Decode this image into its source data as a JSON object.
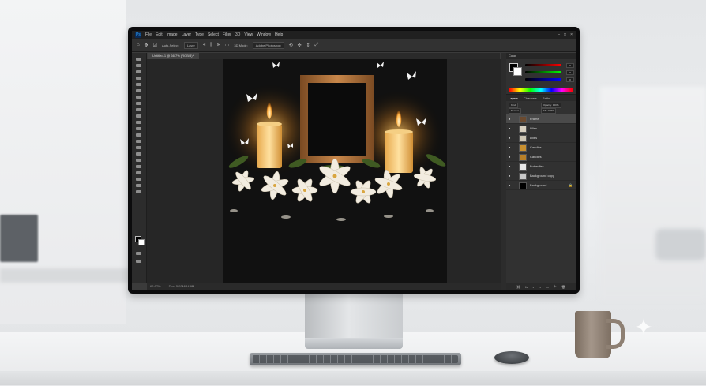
{
  "menubar": {
    "logo": "Ps",
    "items": [
      "File",
      "Edit",
      "Image",
      "Layer",
      "Type",
      "Select",
      "Filter",
      "3D",
      "View",
      "Window",
      "Help"
    ]
  },
  "options_bar": {
    "tool_icon": "move-tool-icon",
    "auto_select_label": "Auto-Select:",
    "auto_select_value": "Layer",
    "mode_label": "3D Mode:",
    "workspace_value": "Adobe Photoshop"
  },
  "document": {
    "tab_title": "Untitled-1 @ 66.7% (RGB/8) *",
    "status": [
      "66.67%",
      "Doc: 5.93M/44.9M"
    ]
  },
  "panels": {
    "color_title": "Color",
    "color_values": [
      "0",
      "0",
      "0"
    ],
    "layer_tabs": [
      "Layers",
      "Channels",
      "Paths"
    ],
    "blend_mode": "Normal",
    "opacity_label": "Opacity: 100%",
    "kind_label": "Kind",
    "fill_label": "Fill: 100%",
    "layers": [
      {
        "name": "Frame",
        "selected": true,
        "thumb": "#6b4a2f"
      },
      {
        "name": "Lilies",
        "selected": false,
        "thumb": "#d8d0c0"
      },
      {
        "name": "Lilies",
        "selected": false,
        "thumb": "#cfc7b5"
      },
      {
        "name": "Candles",
        "selected": false,
        "thumb": "#c89030"
      },
      {
        "name": "Candles",
        "selected": false,
        "thumb": "#b88028"
      },
      {
        "name": "Butterflies",
        "selected": false,
        "thumb": "#e8e8e8"
      },
      {
        "name": "Background copy",
        "selected": false,
        "thumb": "#c9c9c9"
      },
      {
        "name": "Background",
        "selected": false,
        "thumb": "#000000",
        "locked": true
      }
    ],
    "footer_icons": [
      "link-icon",
      "fx-icon",
      "mask-icon",
      "adjustment-icon",
      "folder-icon",
      "new-layer-icon",
      "trash-icon"
    ]
  },
  "colors": {
    "ps_dark": "#323232",
    "ps_darker": "#262626",
    "candle_flame": "#ffb347",
    "frame_wood": "#b0703a"
  }
}
